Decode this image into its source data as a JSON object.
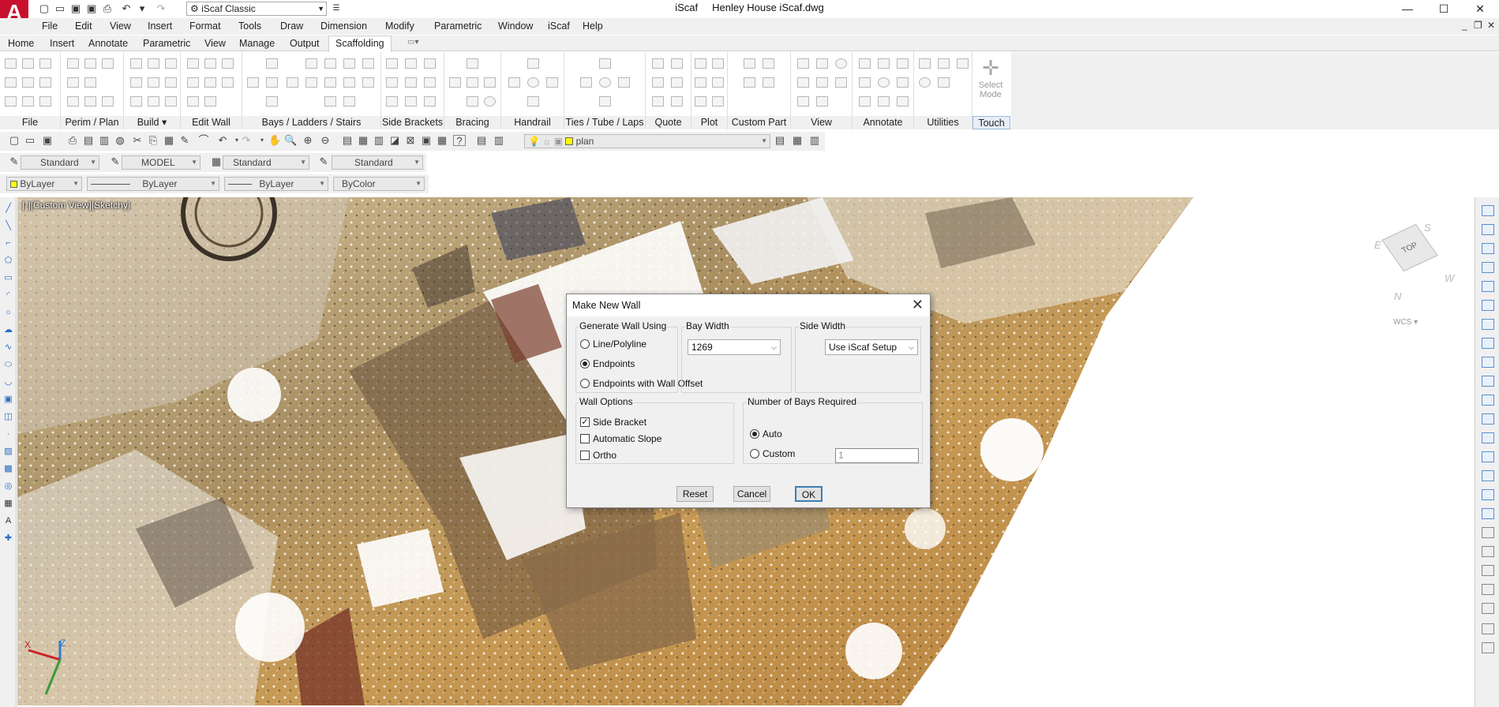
{
  "app": {
    "workspace": "iScaf Classic",
    "title": "iScaf",
    "document": "Henley House iScaf.dwg"
  },
  "menu": [
    "File",
    "Edit",
    "View",
    "Insert",
    "Format",
    "Tools",
    "Draw",
    "Dimension",
    "Modify",
    "Parametric",
    "Window",
    "iScaf",
    "Help"
  ],
  "ribbon_tabs": [
    "Home",
    "Insert",
    "Annotate",
    "Parametric",
    "View",
    "Manage",
    "Output",
    "Scaffolding"
  ],
  "active_tab": "Scaffolding",
  "ribbon_panels": [
    "File",
    "Perim / Plan",
    "Build",
    "Edit Wall",
    "Bays / Ladders / Stairs",
    "Side Brackets",
    "Bracing",
    "Handrail",
    "Ties / Tube / Laps",
    "Quote",
    "Plot",
    "Custom Part",
    "View",
    "Annotate",
    "Utilities",
    "Touch"
  ],
  "select_mode": [
    "Select",
    "Mode"
  ],
  "toolbar_styles": {
    "text_style": "Standard",
    "layout": "MODEL",
    "dim_style": "Standard",
    "table_style": "Standard",
    "layer": "plan"
  },
  "properties": {
    "color": "ByLayer",
    "linetype": "ByLayer",
    "lineweight": "ByLayer",
    "plotstyle": "ByColor"
  },
  "viewport_label": "[-][Custom View][Sketchy]",
  "viewcube": {
    "face": "TOP",
    "n": "N",
    "e": "E",
    "s": "S",
    "w": "W",
    "wcs": "WCS"
  },
  "ucs": {
    "x": "X",
    "z": "Z"
  },
  "dialog": {
    "title": "Make New Wall",
    "generate_label": "Generate Wall Using",
    "generate_options": [
      "Line/Polyline",
      "Endpoints",
      "Endpoints with Wall Offset"
    ],
    "generate_selected": "Endpoints",
    "bay_width_label": "Bay Width",
    "bay_width_value": "1269",
    "side_width_label": "Side Width",
    "side_width_value": "Use iScaf Setup",
    "wall_options_label": "Wall Options",
    "wall_options": [
      {
        "label": "Side Bracket",
        "checked": true
      },
      {
        "label": "Automatic Slope",
        "checked": false
      },
      {
        "label": "Ortho",
        "checked": false
      }
    ],
    "bays_label": "Number of Bays Required",
    "bays_auto": "Auto",
    "bays_custom": "Custom",
    "bays_selected": "Auto",
    "bays_custom_value": "1",
    "reset": "Reset",
    "cancel": "Cancel",
    "ok": "OK"
  }
}
